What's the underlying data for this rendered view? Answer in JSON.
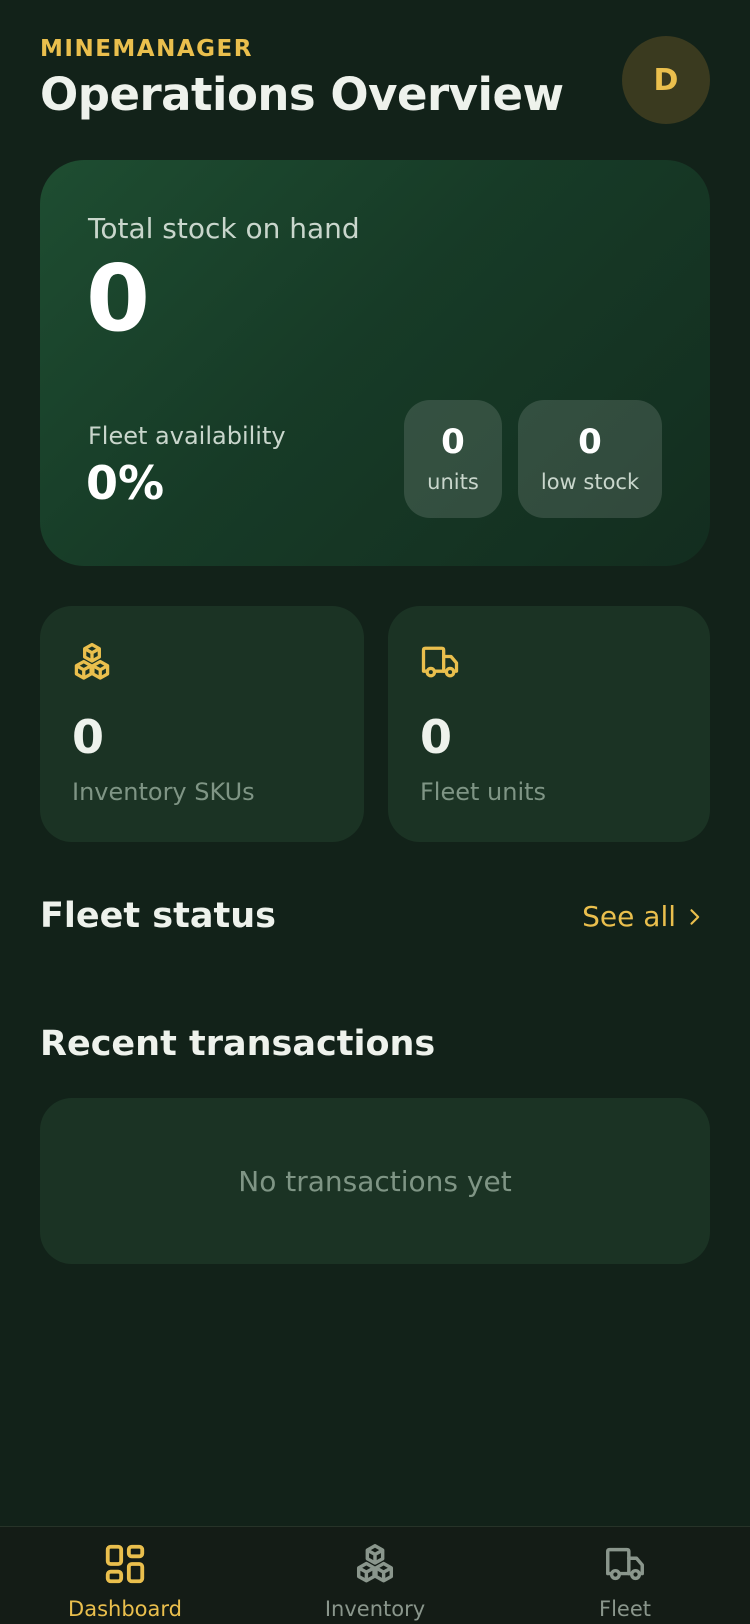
{
  "header": {
    "brand": "MINEMANAGER",
    "title": "Operations Overview",
    "avatar_initial": "D"
  },
  "hero": {
    "stock_label": "Total stock on hand",
    "stock_value": "0",
    "availability_label": "Fleet availability",
    "availability_value": "0%",
    "units_value": "0",
    "units_label": "units",
    "low_stock_value": "0",
    "low_stock_label": "low stock"
  },
  "stats": {
    "inventory": {
      "value": "0",
      "label": "Inventory SKUs",
      "icon": "boxes-icon"
    },
    "fleet": {
      "value": "0",
      "label": "Fleet units",
      "icon": "truck-icon"
    }
  },
  "fleet_status": {
    "title": "Fleet status",
    "see_all": "See all"
  },
  "transactions": {
    "title": "Recent transactions",
    "empty_text": "No transactions yet"
  },
  "nav": {
    "items": [
      {
        "label": "Dashboard",
        "icon": "dashboard-icon",
        "active": true
      },
      {
        "label": "Inventory",
        "icon": "boxes-icon",
        "active": false
      },
      {
        "label": "Fleet",
        "icon": "truck-icon",
        "active": false
      }
    ]
  },
  "colors": {
    "background": "#122219",
    "accent": "#eabf4d",
    "card": "#1b3324",
    "muted": "#7f9585",
    "nav_inactive": "#8a968c"
  }
}
